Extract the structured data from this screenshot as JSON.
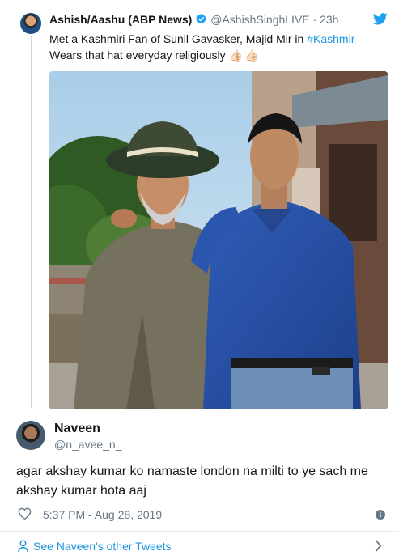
{
  "quoted_tweet": {
    "author_name": "Ashish/Aashu (ABP News)",
    "author_handle": "@AshishSinghLIVE",
    "dot": "·",
    "time": "23h",
    "text_line1_prefix": "Met a Kashmiri Fan of Sunil Gavasker, Majid Mir in ",
    "hashtag": "#Kashmir",
    "text_line2": "Wears that hat everyday religiously",
    "emoji": "👍🏻👍🏻"
  },
  "reply": {
    "author_name": "Naveen",
    "author_handle": "@n_avee_n_",
    "text": "agar akshay kumar ko namaste london na milti to ye sach me akshay kumar hota aaj",
    "timestamp": "5:37 PM - Aug 28, 2019"
  },
  "footer": {
    "see_more": "See Naveen's other Tweets"
  },
  "colors": {
    "link": "#1b95e0",
    "secondary_text": "#657786",
    "divider": "#e6ecf0"
  },
  "icons": [
    "verified-badge-icon",
    "twitter-bird-icon",
    "heart-icon",
    "info-icon",
    "person-icon",
    "chevron-right-icon"
  ]
}
